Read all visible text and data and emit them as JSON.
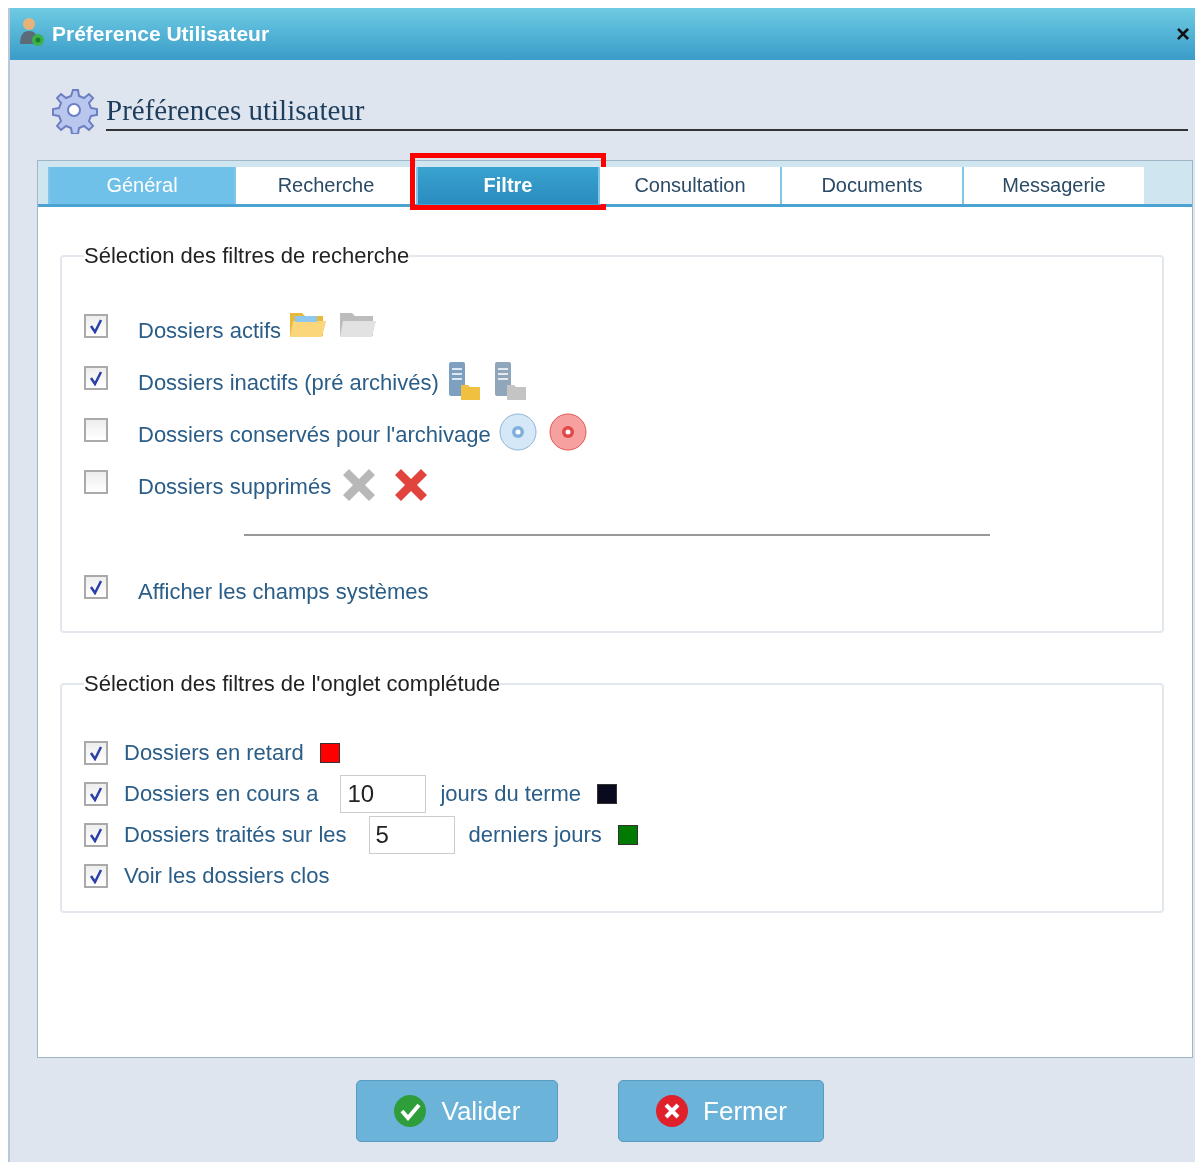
{
  "window": {
    "title": "Préference Utilisateur",
    "close": "×"
  },
  "heading": "Préférences utilisateur",
  "tabs": [
    {
      "label": "Général",
      "selected": false,
      "hovered": true,
      "outlined": false
    },
    {
      "label": "Recherche",
      "selected": false,
      "hovered": false,
      "outlined": false
    },
    {
      "label": "Filtre",
      "selected": true,
      "hovered": false,
      "outlined": true
    },
    {
      "label": "Consultation",
      "selected": false,
      "hovered": false,
      "outlined": false
    },
    {
      "label": "Documents",
      "selected": false,
      "hovered": false,
      "outlined": false
    },
    {
      "label": "Messagerie",
      "selected": false,
      "hovered": false,
      "outlined": false
    }
  ],
  "search_filters": {
    "legend": "Sélection des filtres de recherche",
    "rows": [
      {
        "label": "Dossiers actifs",
        "checked": true
      },
      {
        "label": "Dossiers inactifs (pré archivés)",
        "checked": true
      },
      {
        "label": "Dossiers conservés pour l'archivage",
        "checked": false
      },
      {
        "label": "Dossiers supprimés",
        "checked": false
      }
    ],
    "system_fields": {
      "label": "Afficher les champs systèmes",
      "checked": true
    }
  },
  "completeness_filters": {
    "legend": "Sélection des filtres de l'onglet complétude",
    "rows": [
      {
        "label": "Dossiers en retard",
        "checked": true,
        "color": "#ff0000"
      },
      {
        "label": "Dossiers en cours a",
        "checked": true,
        "value": "10",
        "suffix": "jours du terme",
        "color": "#0a0a1e"
      },
      {
        "label": "Dossiers traités sur les",
        "checked": true,
        "value": "5",
        "suffix": "derniers jours",
        "color": "#007a00"
      },
      {
        "label": "Voir les dossiers clos",
        "checked": true
      }
    ]
  },
  "buttons": [
    {
      "label": "Valider",
      "kind": "ok"
    },
    {
      "label": "Fermer",
      "kind": "cancel"
    }
  ]
}
